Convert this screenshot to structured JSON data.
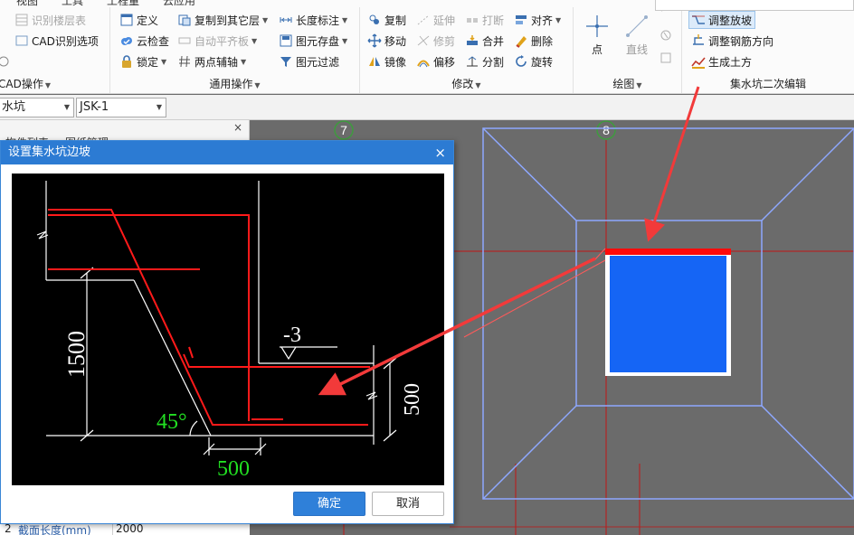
{
  "ribbon": {
    "top_tabs": [
      "视图",
      "工具",
      "工程量",
      "云应用"
    ],
    "groups": {
      "cad": {
        "title": "CAD操作",
        "items": [
          {
            "label": "识别楼层表",
            "disabled": true
          },
          {
            "label": "CAD识别选项",
            "disabled": false
          }
        ]
      },
      "common": {
        "title": "通用操作",
        "items": [
          {
            "label": "定义",
            "disabled": false
          },
          {
            "label": "云检查",
            "disabled": false
          },
          {
            "label": "锁定",
            "disabled": false
          },
          {
            "label": "复制到其它层",
            "disabled": false
          },
          {
            "label": "自动平齐板",
            "disabled": true
          },
          {
            "label": "两点辅轴",
            "disabled": false
          },
          {
            "label": "长度标注",
            "disabled": false
          },
          {
            "label": "图元存盘",
            "disabled": false
          },
          {
            "label": "图元过滤",
            "disabled": false
          }
        ]
      },
      "modify": {
        "title": "修改",
        "items": [
          {
            "label": "复制",
            "disabled": false
          },
          {
            "label": "移动",
            "disabled": false
          },
          {
            "label": "镜像",
            "disabled": false
          },
          {
            "label": "延伸",
            "disabled": true
          },
          {
            "label": "修剪",
            "disabled": true
          },
          {
            "label": "偏移",
            "disabled": false
          },
          {
            "label": "打断",
            "disabled": true
          },
          {
            "label": "合并",
            "disabled": false
          },
          {
            "label": "分割",
            "disabled": false
          },
          {
            "label": "对齐",
            "disabled": false
          },
          {
            "label": "删除",
            "disabled": false
          },
          {
            "label": "旋转",
            "disabled": false
          }
        ]
      },
      "draw": {
        "title": "绘图",
        "point_label": "点",
        "line_label": "直线"
      },
      "pit": {
        "title": "集水坑二次编辑",
        "items": [
          {
            "label": "调整放坡",
            "selected": true
          },
          {
            "label": "调整钢筋方向",
            "selected": false
          },
          {
            "label": "生成土方",
            "selected": false
          }
        ]
      }
    }
  },
  "combobar": {
    "type_value": "水坑",
    "name_value": "JSK-1"
  },
  "leftpanel": {
    "close": "×",
    "tabs": [
      "构件列表",
      "图纸管理"
    ],
    "property_row": {
      "index": "2",
      "name": "截面长度(mm)",
      "value": "2000"
    }
  },
  "canvas": {
    "axis_labels": [
      "7",
      "8"
    ]
  },
  "dialog": {
    "title": "设置集水坑边坡",
    "close": "×",
    "dims": {
      "depth": "1500",
      "offset": "-3",
      "height": "500",
      "angle": "45°",
      "width": "500"
    },
    "ok_label": "确定",
    "cancel_label": "取消"
  },
  "colors": {
    "accent_blue": "#2c7bd3",
    "pit_fill": "#1565f5",
    "rebar_red": "#ff1a1a",
    "outline_blue": "#8ea8ff",
    "axis_green": "#3f9b3f"
  }
}
